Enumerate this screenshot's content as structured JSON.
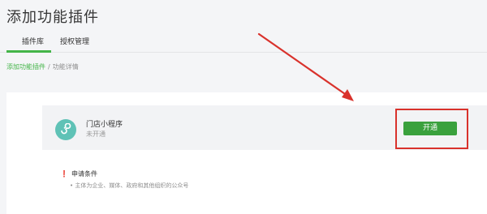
{
  "header": {
    "title": "添加功能插件"
  },
  "tabs": [
    {
      "label": "插件库",
      "active": true
    },
    {
      "label": "授权管理",
      "active": false
    }
  ],
  "breadcrumb": {
    "link": "添加功能插件",
    "separator": "/",
    "current": "功能详情"
  },
  "plugin": {
    "name": "门店小程序",
    "status": "未开通",
    "icon": "store-mini-program-icon",
    "icon_color": "#5fc2b6"
  },
  "action": {
    "open_label": "开通",
    "button_color": "#3aa13d"
  },
  "requirements": {
    "title": "申请条件",
    "items": [
      "主体为企业、媒体、政府和其他组织的公众号"
    ]
  },
  "annotation": {
    "color": "#d9322c"
  },
  "colors": {
    "accent": "#44b549"
  }
}
